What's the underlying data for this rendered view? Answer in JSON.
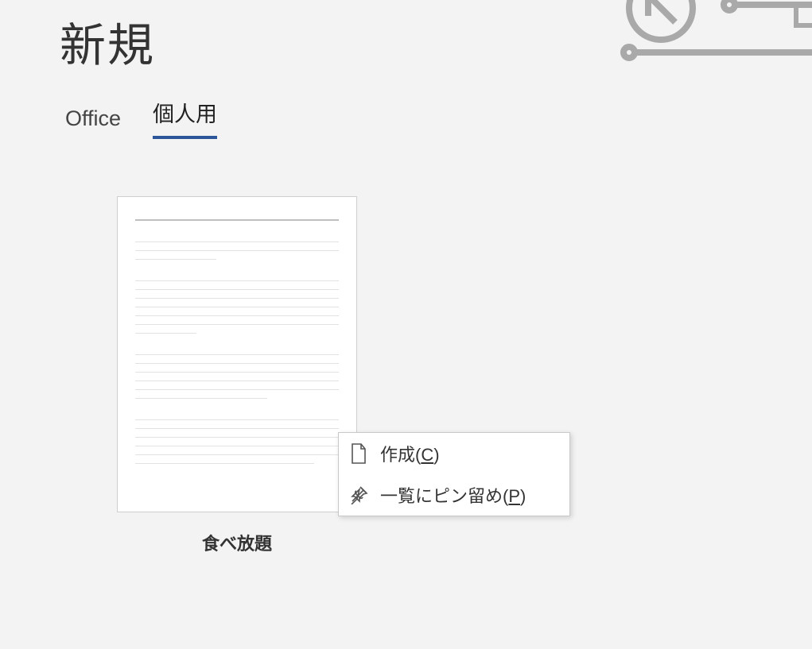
{
  "page": {
    "title": "新規"
  },
  "tabs": {
    "office": {
      "label": "Office"
    },
    "personal": {
      "label": "個人用"
    }
  },
  "templates": [
    {
      "label": "食べ放題"
    }
  ],
  "context_menu": {
    "create": {
      "label_pre": "作成(",
      "key": "C",
      "label_post": ")"
    },
    "pin": {
      "label_pre": "一覧にピン留め(",
      "key": "P",
      "label_post": ")"
    }
  }
}
